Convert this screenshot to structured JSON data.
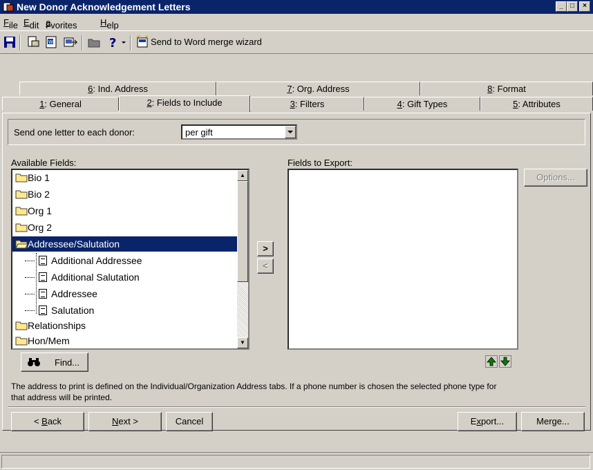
{
  "window": {
    "title": "New Donor Acknowledgement Letters"
  },
  "menu": [
    {
      "pre": "",
      "key": "F",
      "post": "ile"
    },
    {
      "pre": "",
      "key": "E",
      "post": "dit"
    },
    {
      "pre": "F",
      "key": "a",
      "post": "vorites"
    },
    {
      "pre": "",
      "key": "H",
      "post": "elp"
    }
  ],
  "toolbar": {
    "wizard_label": "Send to Word merge wizard"
  },
  "tabs_back": [
    {
      "key": "6",
      "label": ": Ind. Address"
    },
    {
      "key": "7",
      "label": ": Org. Address"
    },
    {
      "key": "8",
      "label": ": Format"
    }
  ],
  "tabs_front": [
    {
      "key": "1",
      "label": ": General"
    },
    {
      "key": "2",
      "label": ": Fields to Include"
    },
    {
      "key": "3",
      "label": ": Filters"
    },
    {
      "key": "4",
      "label": ": Gift Types"
    },
    {
      "key": "5",
      "label": ": Attributes"
    }
  ],
  "send_letter": {
    "label": "Send one letter to each donor:",
    "value": "per gift"
  },
  "available": {
    "label": "Available Fields:",
    "items": [
      "Bio 1",
      "Bio 2",
      "Org 1",
      "Org 2",
      "Addressee/Salutation",
      "Additional Addressee",
      "Additional Salutation",
      "Addressee",
      "Salutation",
      "Relationships",
      "Hon/Mem"
    ]
  },
  "export": {
    "label": "Fields to Export:"
  },
  "buttons": {
    "add": ">",
    "remove": "<",
    "options": "Options...",
    "find": "Find...",
    "back_key": "B",
    "back_post": "ack",
    "next_key": "N",
    "next_post": "ext >",
    "cancel": "Cancel",
    "export_pre": "E",
    "export_key": "x",
    "export_post": "port...",
    "merge": "Merge..."
  },
  "note": "The address to print is defined on the Individual/Organization Address tabs. If a phone number is chosen the selected phone type for that address will be printed.",
  "colors": {
    "title_bar": "#0a246a",
    "face": "#d4d0c8",
    "selection": "#0a246a"
  }
}
